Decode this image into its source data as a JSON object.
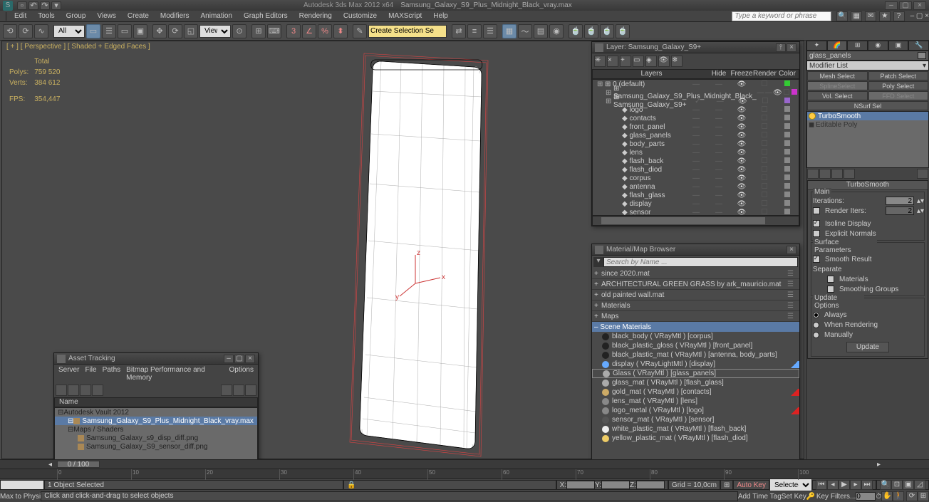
{
  "title": {
    "app": "Autodesk 3ds Max  2012 x64",
    "file": "Samsung_Galaxy_S9_Plus_Midnight_Black_vray.max"
  },
  "menu": [
    "Edit",
    "Tools",
    "Group",
    "Views",
    "Create",
    "Modifiers",
    "Animation",
    "Graph Editors",
    "Rendering",
    "Customize",
    "MAXScript",
    "Help"
  ],
  "search_placeholder": "Type a keyword or phrase",
  "toolbar": {
    "ref_drop": "All",
    "view_drop": "View",
    "sel_label": "Create Selection Se"
  },
  "viewport": {
    "label": "[ + ] [ Perspective ] [ Shaded + Edged Faces ]",
    "stats": {
      "h_total": "Total",
      "polys_l": "Polys:",
      "polys": "759 520",
      "verts_l": "Verts:",
      "verts": "384 612",
      "fps_l": "FPS:",
      "fps": "354,447"
    }
  },
  "right": {
    "obj_name": "glass_panels",
    "modlist": "Modifier List",
    "btns": [
      "Mesh Select",
      "Patch Select",
      "SplineSelect",
      "Poly Select",
      "Vol. Select",
      "FFD Select",
      "NSurf Sel"
    ],
    "stack": [
      "TurboSmooth",
      "Editable Poly"
    ],
    "roll_title": "TurboSmooth",
    "grp_main": "Main",
    "iter_l": "Iterations:",
    "iter": "2",
    "render_iter_l": "Render Iters:",
    "render_iter": "2",
    "iso": "Isoline Display",
    "expl": "Explicit Normals",
    "surf": "Surface Parameters",
    "smooth": "Smooth Result",
    "sep": "Separate",
    "mats": "Materials",
    "sg": "Smoothing Groups",
    "upd": "Update Options",
    "always": "Always",
    "render": "When Rendering",
    "manual": "Manually",
    "upbtn": "Update"
  },
  "asset": {
    "title": "Asset Tracking",
    "menu": [
      "Server",
      "File",
      "Paths",
      "Bitmap Performance and Memory",
      "Options"
    ],
    "col": "Name",
    "rows": [
      {
        "t": "Autodesk Vault 2012",
        "d": 0
      },
      {
        "t": "Samsung_Galaxy_S9_Plus_Midnight_Black_vray.max",
        "d": 1,
        "sel": true
      },
      {
        "t": "Maps / Shaders",
        "d": 1
      },
      {
        "t": "Samsung_Galaxy_s9_disp_diff.png",
        "d": 2
      },
      {
        "t": "Samsung_Galaxy_S9_sensor_diff.png",
        "d": 2
      }
    ]
  },
  "layer": {
    "title": "Layer: Samsung_Galaxy_S9+",
    "cols": [
      "Layers",
      "Hide",
      "Freeze",
      "Render",
      "Color"
    ],
    "rows": [
      {
        "n": "0 (default)",
        "d": 0,
        "c": "#33cc33"
      },
      {
        "n": "Samsung_Galaxy_S9_Plus_Midnight_Black_",
        "d": 1,
        "c": "#cc33cc"
      },
      {
        "n": "Samsung_Galaxy_S9+",
        "d": 1,
        "c": "#9966cc",
        "chk": true
      },
      {
        "n": "logo",
        "d": 2,
        "c": "#888"
      },
      {
        "n": "contacts",
        "d": 2,
        "c": "#888"
      },
      {
        "n": "front_panel",
        "d": 2,
        "c": "#888"
      },
      {
        "n": "glass_panels",
        "d": 2,
        "c": "#888"
      },
      {
        "n": "body_parts",
        "d": 2,
        "c": "#888"
      },
      {
        "n": "lens",
        "d": 2,
        "c": "#888"
      },
      {
        "n": "flash_back",
        "d": 2,
        "c": "#888"
      },
      {
        "n": "flash_diod",
        "d": 2,
        "c": "#888"
      },
      {
        "n": "corpus",
        "d": 2,
        "c": "#888"
      },
      {
        "n": "antenna",
        "d": 2,
        "c": "#888"
      },
      {
        "n": "flash_glass",
        "d": 2,
        "c": "#888"
      },
      {
        "n": "display",
        "d": 2,
        "c": "#888"
      },
      {
        "n": "sensor",
        "d": 2,
        "c": "#888"
      }
    ]
  },
  "mat": {
    "title": "Material/Map Browser",
    "search": "Search by Name ...",
    "libs": [
      "since 2020.mat",
      "ARCHITECTURAL GREEN GRASS by ark_mauricio.mat",
      "old painted wall.mat",
      "Materials",
      "Maps"
    ],
    "scene_head": "Scene Materials",
    "items": [
      {
        "n": "black_body ( VRayMtl ) [corpus]",
        "c": "#222"
      },
      {
        "n": "black_plastic_gloss ( VRayMtl ) [front_panel]",
        "c": "#222"
      },
      {
        "n": "black_plastic_mat ( VRayMtl ) [antenna, body_parts]",
        "c": "#222"
      },
      {
        "n": "display ( VRayLightMtl ) [display]",
        "c": "#6af",
        "flag": "#6af"
      },
      {
        "n": "Glass ( VRayMtl ) [glass_panels]",
        "c": "#aaa",
        "sel": true
      },
      {
        "n": "glass_mat ( VRayMtl ) [flash_glass]",
        "c": "#aaa"
      },
      {
        "n": "gold_mat ( VRayMtl ) [contacts]",
        "c": "#ca6",
        "flag": "#d22"
      },
      {
        "n": "lens_mat ( VRayMtl ) [lens]",
        "c": "#888"
      },
      {
        "n": "logo_metal ( VRayMtl ) [logo]",
        "c": "#888",
        "flag": "#d22"
      },
      {
        "n": "sensor_mat ( VRayMtl ) [sensor]",
        "c": "#555"
      },
      {
        "n": "white_plastic_mat ( VRayMtl ) [flash_back]",
        "c": "#eee"
      },
      {
        "n": "yellow_plastic_mat ( VRayMtl ) [flash_diod]",
        "c": "#ec6"
      }
    ]
  },
  "bottom": {
    "frame": "0 / 100",
    "ticks": [
      "0",
      "10",
      "20",
      "30",
      "40",
      "50",
      "60",
      "70",
      "80",
      "90",
      "100"
    ],
    "script": "Max to Physi",
    "sel": "1 Object Selected",
    "x": "X:",
    "y": "Y:",
    "z": "Z:",
    "grid": "Grid = 10,0cm",
    "auto": "Auto Key",
    "selected": "Selected",
    "set": "Set Key",
    "keyf": "Key Filters...",
    "prompt": "Click and click-and-drag to select objects",
    "tag": "Add Time Tag"
  }
}
